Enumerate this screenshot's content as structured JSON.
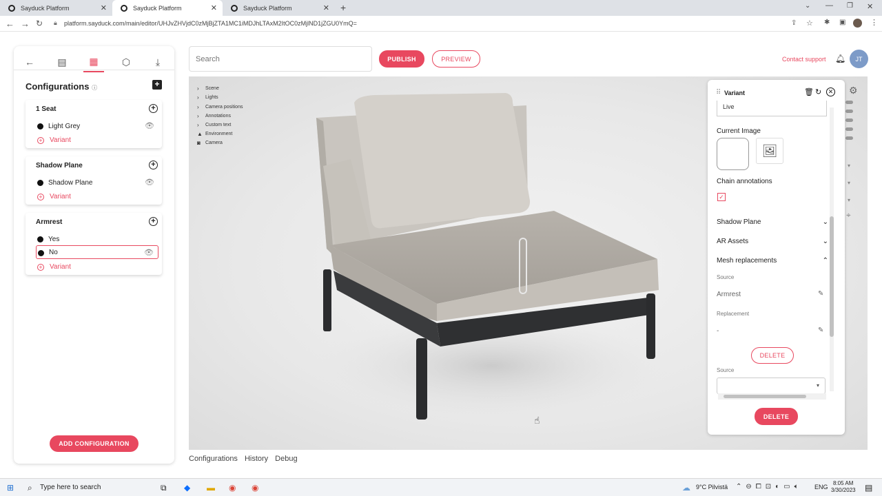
{
  "browser": {
    "tabs": [
      {
        "title": "Sayduck Platform"
      },
      {
        "title": "Sayduck Platform"
      },
      {
        "title": "Sayduck Platform"
      }
    ],
    "url": "platform.sayduck.com/main/editor/UHJvZHVjdC0zMjBjZTA1MC1iMDJhLTAxM2ItOC0zMjlND1jZGU0YmQ="
  },
  "left_panel": {
    "tabs": [
      "back-arrow-icon",
      "document-icon",
      "grid-icon",
      "cube-icon",
      "download-icon"
    ],
    "title": "Configurations",
    "configurations": [
      {
        "name": "1 Seat",
        "options": [
          {
            "label": "Light Grey",
            "selected": false
          }
        ],
        "variant_label": "Variant"
      },
      {
        "name": "Shadow Plane",
        "options": [
          {
            "label": "Shadow Plane",
            "selected": false
          }
        ],
        "variant_label": "Variant"
      },
      {
        "name": "Armrest",
        "options": [
          {
            "label": "Yes",
            "selected": false
          },
          {
            "label": "No",
            "selected": true
          }
        ],
        "variant_label": "Variant"
      }
    ],
    "add_button": "ADD CONFIGURATION"
  },
  "toolbar": {
    "search_placeholder": "Search",
    "publish": "PUBLISH",
    "preview": "PREVIEW",
    "contact": "Contact support",
    "avatar": "JT"
  },
  "scene_tree": [
    "Scene",
    "Lights",
    "Camera positions",
    "Annotations",
    "Custom text",
    "Environment",
    "Camera"
  ],
  "bottom_tabs": [
    "Configurations",
    "History",
    "Debug"
  ],
  "right_panel": {
    "title": "Variant",
    "status_value": "Live",
    "current_image_label": "Current Image",
    "chain_annotations_label": "Chain annotations",
    "sections": [
      "Shadow Plane",
      "AR Assets",
      "Mesh replacements"
    ],
    "source_label": "Source",
    "source_value": "Armrest",
    "replacement_label": "Replacement",
    "replacement_value": "-",
    "delete_inner": "DELETE",
    "source_label_2": "Source",
    "delete_outer": "DELETE"
  },
  "taskbar": {
    "search_text": "Type here to search",
    "weather": "9°C  Pilvistä",
    "lang": "ENG",
    "time": "8:05 AM",
    "date": "3/30/2023"
  },
  "colors": {
    "accent": "#e8485f",
    "avatar": "#7d9bc8"
  }
}
